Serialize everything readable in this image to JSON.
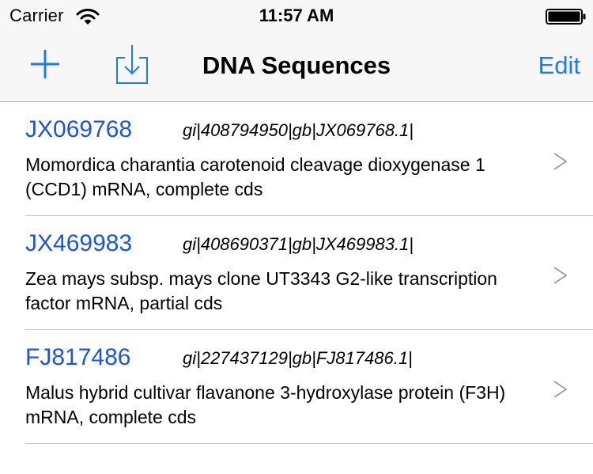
{
  "status_bar": {
    "carrier": "Carrier",
    "time": "11:57 AM",
    "wifi_icon": "wifi-icon",
    "battery_icon": "battery-icon"
  },
  "nav_bar": {
    "title": "DNA Sequences",
    "add_icon": "plus-icon",
    "import_icon": "download-tray-icon",
    "edit_label": "Edit",
    "tint_color": "#1a7cf5"
  },
  "sequences": [
    {
      "accession": "JX069768",
      "gi": "gi|408794950|gb|JX069768.1|",
      "description": "Momordica charantia carotenoid cleavage dioxygenase 1 (CCD1) mRNA, complete cds"
    },
    {
      "accession": "JX469983",
      "gi": "gi|408690371|gb|JX469983.1|",
      "description": "Zea mays subsp. mays clone UT3343 G2-like transcription factor mRNA, partial cds"
    },
    {
      "accession": "FJ817486",
      "gi": "gi|227437129|gb|FJ817486.1|",
      "description": "Malus hybrid cultivar flavanone 3-hydroxylase protein (F3H) mRNA, complete cds"
    }
  ],
  "colors": {
    "accession_link": "#1a55e0",
    "separator": "#c8c7cc",
    "bar_background": "#f7f7f7"
  }
}
